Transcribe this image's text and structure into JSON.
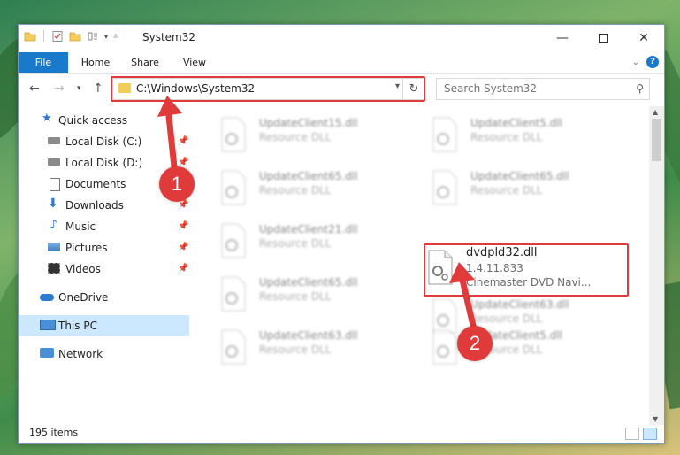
{
  "window": {
    "title": "System32"
  },
  "ribbon": {
    "tabs": [
      "File",
      "Home",
      "Share",
      "View"
    ]
  },
  "address": {
    "path": "C:\\Windows\\System32"
  },
  "search": {
    "placeholder": "Search System32"
  },
  "sidebar": {
    "items": [
      {
        "label": "Quick access",
        "icon": "star-icon"
      },
      {
        "label": "Local Disk (C:)",
        "icon": "drive-icon"
      },
      {
        "label": "Local Disk (D:)",
        "icon": "drive-icon"
      },
      {
        "label": "Documents",
        "icon": "document-icon"
      },
      {
        "label": "Downloads",
        "icon": "download-icon"
      },
      {
        "label": "Music",
        "icon": "music-icon"
      },
      {
        "label": "Pictures",
        "icon": "picture-icon"
      },
      {
        "label": "Videos",
        "icon": "video-icon"
      },
      {
        "label": "OneDrive",
        "icon": "cloud-icon"
      },
      {
        "label": "This PC",
        "icon": "computer-icon"
      },
      {
        "label": "Network",
        "icon": "network-icon"
      }
    ]
  },
  "files": [
    {
      "name": "UpdateClient15.dll",
      "line1": "Resource DLL",
      "line2": ""
    },
    {
      "name": "UpdateClient5.dll",
      "line1": "Resource DLL",
      "line2": ""
    },
    {
      "name": "UpdateClient65.dll",
      "line1": "Resource DLL",
      "line2": ""
    },
    {
      "name": "UpdateClient65.dll",
      "line1": "Resource DLL",
      "line2": ""
    },
    {
      "name": "UpdateClient21.dll",
      "line1": "Resource DLL",
      "line2": ""
    },
    {
      "name": "dvdpld32.dll",
      "line1": "1.4.11.833",
      "line2": "Cinemaster DVD Navi..."
    },
    {
      "name": "UpdateClient65.dll",
      "line1": "Resource DLL",
      "line2": ""
    },
    {
      "name": "UpdateClient63.dll",
      "line1": "Resource DLL",
      "line2": ""
    },
    {
      "name": "UpdateClient63.dll",
      "line1": "Resource DLL",
      "line2": ""
    },
    {
      "name": "UpdateClient5.dll",
      "line1": "Resource DLL",
      "line2": ""
    }
  ],
  "status": {
    "count": "195 items"
  },
  "callouts": [
    "1",
    "2"
  ],
  "colors": {
    "accent": "#1979ca",
    "highlight": "#e03a3a",
    "selected": "#cce8ff"
  }
}
